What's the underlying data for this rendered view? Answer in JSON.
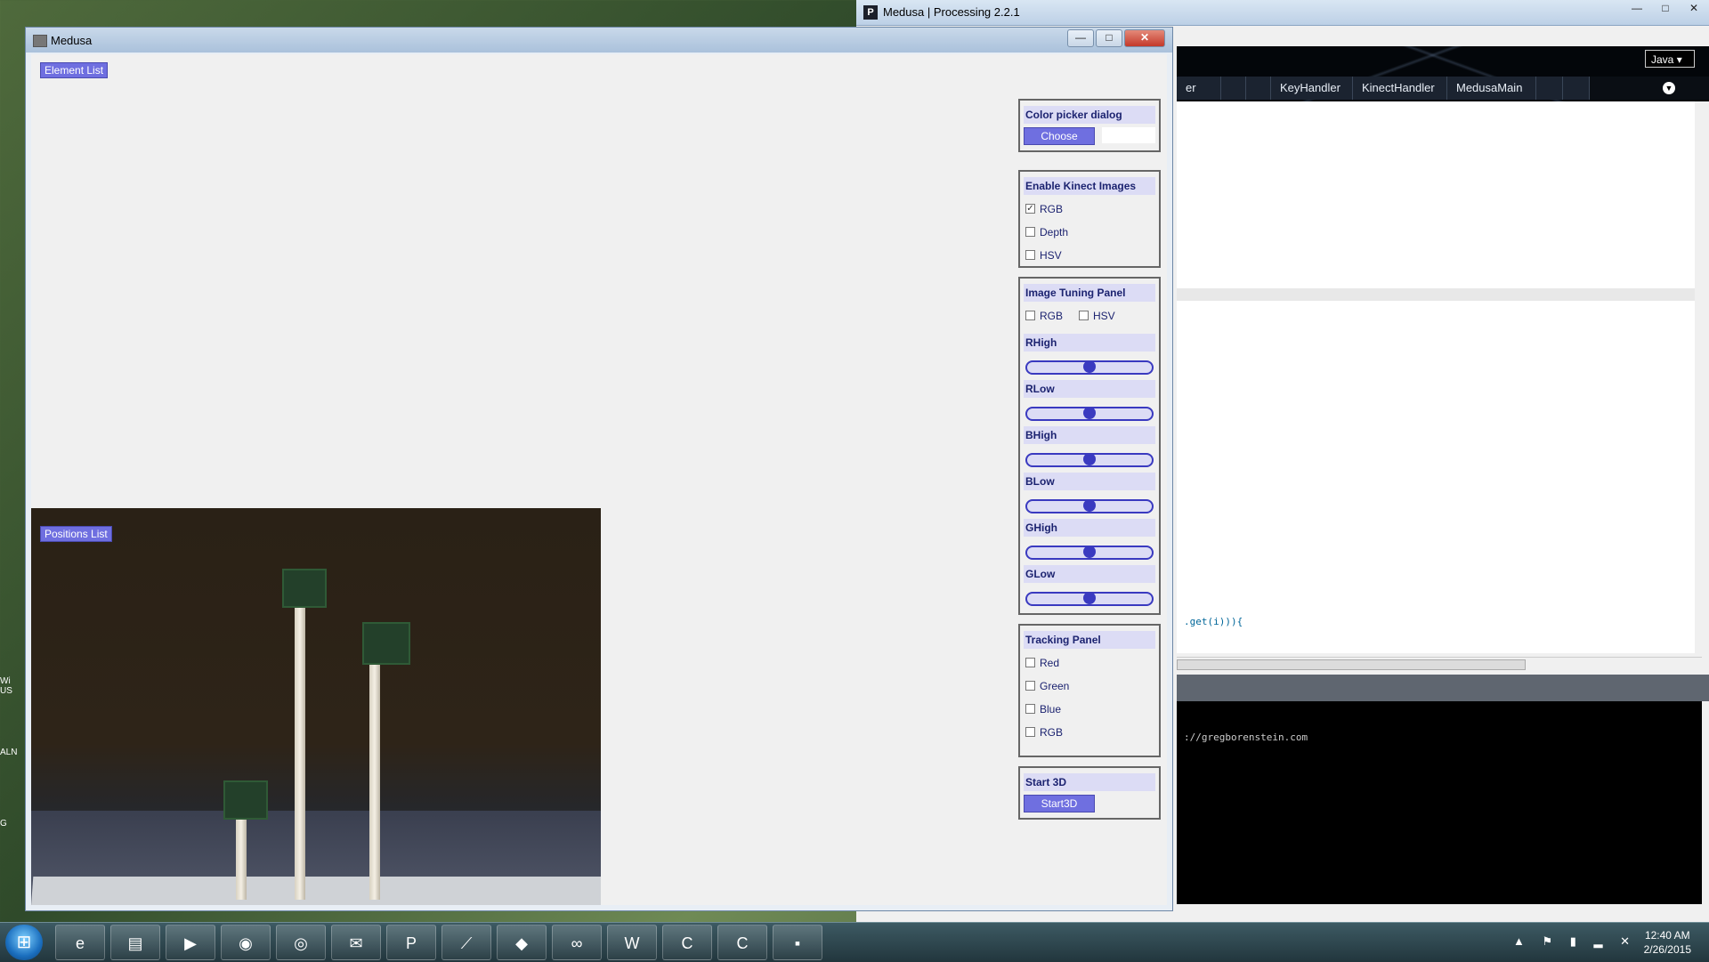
{
  "ide": {
    "title": "Medusa | Processing 2.2.1",
    "window_controls": [
      "—",
      "□",
      "✕"
    ],
    "mode": "Java",
    "tabs": [
      "er",
      "KeyHandler",
      "KinectHandler",
      "MedusaMain"
    ],
    "code_line": ".get(i))){",
    "console_line": "://gregborenstein.com"
  },
  "desktop": {
    "icon_labels": [
      "Wi US",
      "ALN",
      "G"
    ]
  },
  "medusa": {
    "title": "Medusa",
    "window_controls": [
      "—",
      "□",
      "✕"
    ],
    "element_list_label": "Element List",
    "positions_list_label": "Positions List",
    "color_picker": {
      "title": "Color picker dialog",
      "button": "Choose",
      "swatch_color": "#ffffff"
    },
    "kinect_images": {
      "title": "Enable Kinect Images",
      "options": [
        {
          "label": "RGB",
          "checked": true
        },
        {
          "label": "Depth",
          "checked": false
        },
        {
          "label": "HSV",
          "checked": false
        }
      ]
    },
    "image_tuning": {
      "title": "Image Tuning Panel",
      "mode_options": [
        {
          "label": "RGB",
          "checked": false
        },
        {
          "label": "HSV",
          "checked": false
        }
      ],
      "sliders": [
        {
          "label": "RHigh",
          "value": 0.5
        },
        {
          "label": "RLow",
          "value": 0.5
        },
        {
          "label": "BHigh",
          "value": 0.5
        },
        {
          "label": "BLow",
          "value": 0.5
        },
        {
          "label": "GHigh",
          "value": 0.5
        },
        {
          "label": "GLow",
          "value": 0.5
        }
      ]
    },
    "tracking": {
      "title": "Tracking Panel",
      "options": [
        {
          "label": "Red",
          "checked": false
        },
        {
          "label": "Green",
          "checked": false
        },
        {
          "label": "Blue",
          "checked": false
        },
        {
          "label": "RGB",
          "checked": false
        }
      ]
    },
    "start3d": {
      "title": "Start 3D",
      "button": "Start3D"
    },
    "accent_color": "#6f6fe0",
    "panel_title_color": "#1c2370"
  },
  "taskbar": {
    "start_icon": "windows-start-icon",
    "apps": [
      {
        "icon": "internet-explorer-icon",
        "glyph": "e"
      },
      {
        "icon": "file-explorer-icon",
        "glyph": "▤"
      },
      {
        "icon": "media-player-icon",
        "glyph": "▶"
      },
      {
        "icon": "firefox-icon",
        "glyph": "◉"
      },
      {
        "icon": "chrome-icon",
        "glyph": "◎"
      },
      {
        "icon": "outlook-icon",
        "glyph": "✉"
      },
      {
        "icon": "processing-icon",
        "glyph": "P"
      },
      {
        "icon": "gitbash-icon",
        "glyph": "⟋"
      },
      {
        "icon": "git-icon",
        "glyph": "◆"
      },
      {
        "icon": "arduino-icon",
        "glyph": "∞"
      },
      {
        "icon": "word-icon",
        "glyph": "W"
      },
      {
        "icon": "camtasia-icon",
        "glyph": "C"
      },
      {
        "icon": "camtasia-recorder-icon",
        "glyph": "C"
      },
      {
        "icon": "sketch-window-icon",
        "glyph": "▪"
      }
    ],
    "time": "12:40 AM",
    "date": "2/26/2015"
  }
}
